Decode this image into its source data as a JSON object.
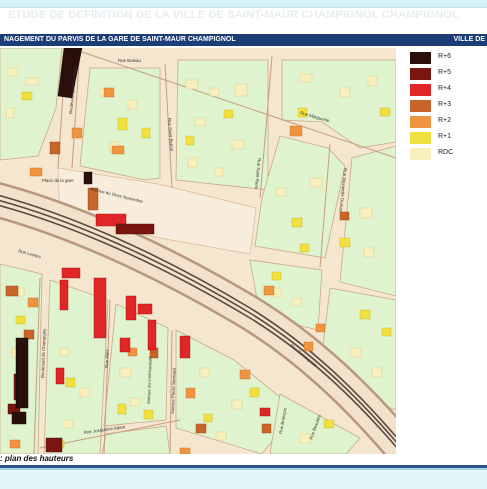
{
  "document": {
    "faded_title": "ETUDE DE DEFINITION DE LA VILLE DE SAINT-MAUR CHAMPIGNOL CHAMPIGNOL",
    "header_left": "NAGEMENT DU PARVIS DE LA GARE DE SAINT-MAUR CHAMPIGNOL",
    "header_right": "VILLE DE",
    "caption": ": plan des hauteurs"
  },
  "legend": {
    "items": [
      {
        "label": "R+6",
        "color": "#2b0f0b"
      },
      {
        "label": "R+5",
        "color": "#7a1510"
      },
      {
        "label": "R+4",
        "color": "#e02626"
      },
      {
        "label": "R+3",
        "color": "#c9652b"
      },
      {
        "label": "R+2",
        "color": "#ef9440"
      },
      {
        "label": "R+1",
        "color": "#f0e040"
      },
      {
        "label": "RDC",
        "color": "#f8f0bc"
      }
    ]
  },
  "map": {
    "streets": {
      "rue_boieau": "Rue Boieau",
      "rue_saint_benoit": "Rue Saint-Benoit",
      "rue_marguerite": "Rue Marguerite",
      "rue_saint_remi": "Rue Saint-Remi",
      "rue_alexandre_dumas": "Rue Alexandre Dumas",
      "bd_champigny_north": "Boulevard de Champigny",
      "avenue_onze_novembre": "Avenue du Onze Novembre",
      "place_gare": "Place de la gare",
      "rue_leclerc": "Rue Leclerc",
      "bd_champigny_south": "Boulevard de Champigny",
      "rue_alais": "Rue Alais",
      "avenue_pierre_sermard": "Avenue Pierre Sermard",
      "rue_joséphine_adam": "Rue Joséphine Adam",
      "rue_bonnegrant": "Rue Bonnegrant",
      "rue_bonaparte": "Rue Bonaparte",
      "rue_briançon": "Rue Briançon",
      "rue_beaulieu": "Rue Beaulieu",
      "avenue_commandant": "Avenue du commandant"
    }
  }
}
